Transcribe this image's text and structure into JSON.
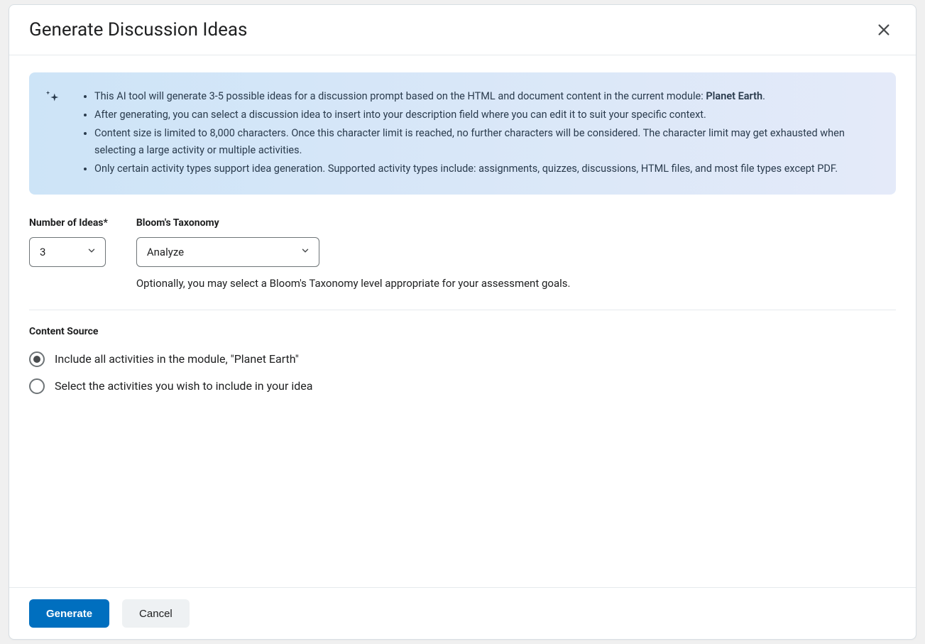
{
  "modal": {
    "title": "Generate Discussion Ideas",
    "info": {
      "bullet1_prefix": "This AI tool will generate 3-5 possible ideas for a discussion prompt based on the HTML and document content in the current module: ",
      "module_name": "Planet Earth",
      "bullet1_suffix": ".",
      "bullet2": "After generating, you can select a discussion idea to insert into your description field where you can edit it to suit your specific context.",
      "bullet3": "Content size is limited to 8,000 characters. Once this character limit is reached, no further characters will be considered. The character limit may get exhausted when selecting a large activity or multiple activities.",
      "bullet4": "Only certain activity types support idea generation. Supported activity types include: assignments, quizzes, discussions, HTML files, and most file types except PDF."
    },
    "fields": {
      "number_label": "Number of Ideas*",
      "number_value": "3",
      "bloom_label": "Bloom's Taxonomy",
      "bloom_value": "Analyze",
      "bloom_helper": "Optionally, you may select a Bloom's Taxonomy level appropriate for your assessment goals."
    },
    "content_source": {
      "label": "Content Source",
      "option1": "Include all activities in the module, \"Planet Earth\"",
      "option2": "Select the activities you wish to include in your idea"
    },
    "footer": {
      "generate": "Generate",
      "cancel": "Cancel"
    }
  }
}
